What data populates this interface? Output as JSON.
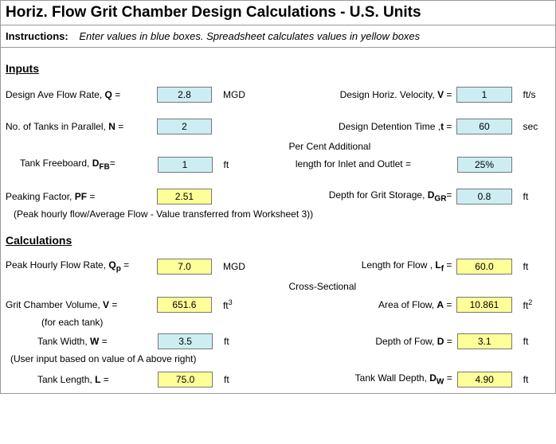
{
  "title": "Horiz. Flow Grit Chamber Design Calculations - U.S. Units",
  "instructions": {
    "label": "Instructions:",
    "text": "Enter values in blue boxes.  Spreadsheet calculates values in yellow boxes"
  },
  "sections": {
    "inputs": "Inputs",
    "calculations": "Calculations"
  },
  "inputs": {
    "Q": {
      "label_pre": "Design Ave Flow Rate, ",
      "sym": "Q",
      "label_post": " =",
      "value": "2.8",
      "unit": "MGD"
    },
    "V": {
      "label_pre": "Design Horiz. Velocity, ",
      "sym": "V",
      "label_post": " =",
      "value": "1",
      "unit": "ft/s"
    },
    "N": {
      "label_pre": "No. of Tanks in Parallel, ",
      "sym": "N",
      "label_post": " =",
      "value": "2",
      "unit": ""
    },
    "t": {
      "label_pre": "Design Detention Time ,",
      "sym": "t",
      "label_post": " =",
      "value": "60",
      "unit": "sec"
    },
    "DFB": {
      "label_pre": "Tank Freeboard, ",
      "sym": "D",
      "sub": "FB",
      "label_post": "=",
      "value": "1",
      "unit": "ft"
    },
    "pctAdd": {
      "line1": "Per Cent Additional",
      "line2": " length  for Inlet and Outlet =",
      "value": "25%",
      "unit": ""
    },
    "PF": {
      "label_pre": "Peaking Factor, ",
      "sym": "PF",
      "label_post": " =",
      "value": "2.51",
      "unit": ""
    },
    "DGR": {
      "label_pre": "Depth for Grit Storage, ",
      "sym": "D",
      "sub": "GR",
      "label_post": "=",
      "value": "0.8",
      "unit": "ft"
    },
    "pf_note": " (Peak hourly flow/Average Flow - Value transferred from Worksheet 3))"
  },
  "calcs": {
    "Qp": {
      "label_pre": "Peak Hourly Flow Rate, ",
      "sym": "Q",
      "sub": "p",
      "label_post": " =",
      "value": "7.0",
      "unit": "MGD"
    },
    "Lf": {
      "label_pre": "Length for Flow , ",
      "sym": "L",
      "sub": "f",
      "label_post": " =",
      "value": "60.0",
      "unit": "ft"
    },
    "Vvol": {
      "label_pre": "Grit Chamber Volume, ",
      "sym": "V",
      "label_post": " =",
      "value": "651.6",
      "unit_html": "ft³",
      "note": "(for each tank)"
    },
    "A": {
      "line1": "Cross-Sectional",
      "label_pre": "Area of Flow,  ",
      "sym": "A",
      "label_post": " =",
      "value": "10.861",
      "unit_html": "ft²"
    },
    "W": {
      "label_pre": "Tank Width,  ",
      "sym": "W",
      "label_post": " =",
      "value": "3.5",
      "unit": "ft",
      "note": " (User input based on value of A above right)"
    },
    "D": {
      "label_pre": "Depth of Fow,  ",
      "sym": "D",
      "label_post": " =",
      "value": "3.1",
      "unit": "ft"
    },
    "L": {
      "label_pre": "Tank Length,  ",
      "sym": "L",
      "label_post": " =",
      "value": "75.0",
      "unit": "ft"
    },
    "DW": {
      "label_pre": "Tank Wall Depth,  ",
      "sym": "D",
      "sub": "W",
      "label_post": " =",
      "value": "4.90",
      "unit": "ft"
    }
  }
}
